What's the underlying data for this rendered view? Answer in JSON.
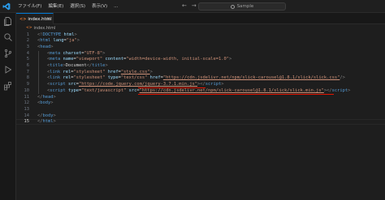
{
  "menu": [
    "ファイル(F)",
    "編集(E)",
    "選択(S)",
    "表示(V)",
    "..."
  ],
  "search": {
    "placeholder": "Sample"
  },
  "tab": {
    "label": "index.html",
    "icon": "html-file-icon"
  },
  "breadcrumb": {
    "label": "index.html"
  },
  "activity_icons": [
    "files-icon",
    "search-icon",
    "source-control-icon",
    "run-debug-icon",
    "extensions-icon"
  ],
  "editor": {
    "active_line": 15,
    "lines": [
      {
        "n": "1",
        "indent": 0,
        "tokens": [
          [
            "b",
            "<!"
          ],
          [
            "tag",
            "DOCTYPE"
          ],
          [
            "t",
            " "
          ],
          [
            "attr",
            "html"
          ],
          [
            "b",
            ">"
          ]
        ]
      },
      {
        "n": "2",
        "indent": 0,
        "tokens": [
          [
            "b",
            "<"
          ],
          [
            "tag",
            "html"
          ],
          [
            "t",
            " "
          ],
          [
            "attr",
            "lang"
          ],
          [
            "t",
            "="
          ],
          [
            "str",
            "\"ja\""
          ],
          [
            "b",
            ">"
          ]
        ]
      },
      {
        "n": "3",
        "indent": 0,
        "tokens": [
          [
            "b",
            "<"
          ],
          [
            "tag",
            "head"
          ],
          [
            "b",
            ">"
          ]
        ]
      },
      {
        "n": "4",
        "indent": 1,
        "tokens": [
          [
            "b",
            "<"
          ],
          [
            "tag",
            "meta"
          ],
          [
            "t",
            " "
          ],
          [
            "attr",
            "charset"
          ],
          [
            "t",
            "="
          ],
          [
            "str",
            "\"UTF-8\""
          ],
          [
            "b",
            ">"
          ]
        ]
      },
      {
        "n": "5",
        "indent": 1,
        "tokens": [
          [
            "b",
            "<"
          ],
          [
            "tag",
            "meta"
          ],
          [
            "t",
            " "
          ],
          [
            "attr",
            "name"
          ],
          [
            "t",
            "="
          ],
          [
            "str",
            "\"viewport\""
          ],
          [
            "t",
            " "
          ],
          [
            "attr",
            "content"
          ],
          [
            "t",
            "="
          ],
          [
            "str",
            "\"width=device-width, initial-scale=1.0\""
          ],
          [
            "b",
            ">"
          ]
        ]
      },
      {
        "n": "6",
        "indent": 1,
        "tokens": [
          [
            "b",
            "<"
          ],
          [
            "tag",
            "title"
          ],
          [
            "b",
            ">"
          ],
          [
            "t",
            "Document"
          ],
          [
            "b",
            "</"
          ],
          [
            "tag",
            "title"
          ],
          [
            "b",
            ">"
          ]
        ]
      },
      {
        "n": "7",
        "indent": 1,
        "tokens": [
          [
            "b",
            "<"
          ],
          [
            "tag",
            "link"
          ],
          [
            "t",
            " "
          ],
          [
            "attr",
            "rel"
          ],
          [
            "t",
            "="
          ],
          [
            "str",
            "\"stylesheet\""
          ],
          [
            "t",
            " "
          ],
          [
            "attr",
            "href"
          ],
          [
            "t",
            "="
          ],
          [
            "link",
            "\"style.css\""
          ],
          [
            "b",
            ">"
          ]
        ]
      },
      {
        "n": "8",
        "indent": 1,
        "tokens": [
          [
            "b",
            "<"
          ],
          [
            "tag",
            "link"
          ],
          [
            "t",
            " "
          ],
          [
            "attr",
            "rel"
          ],
          [
            "t",
            "="
          ],
          [
            "str",
            "\"stylesheet\""
          ],
          [
            "t",
            " "
          ],
          [
            "attr",
            "type"
          ],
          [
            "t",
            "="
          ],
          [
            "str",
            "\"text/css\""
          ],
          [
            "t",
            " "
          ],
          [
            "attr",
            "href"
          ],
          [
            "t",
            "="
          ],
          [
            "link",
            "\"https://cdn.jsdelivr.net/npm/slick-carousel@1.8.1/slick/slick.css\""
          ],
          [
            "b",
            "/>"
          ]
        ]
      },
      {
        "n": "9",
        "indent": 1,
        "tokens": [
          [
            "b",
            "<"
          ],
          [
            "tag",
            "script"
          ],
          [
            "t",
            " "
          ],
          [
            "attr",
            "src"
          ],
          [
            "t",
            "="
          ],
          [
            "link",
            "\"https://code.jquery.com/jquery-3.7.1.min.js\""
          ],
          [
            "b",
            "></"
          ],
          [
            "tag",
            "script"
          ],
          [
            "b",
            ">"
          ]
        ]
      },
      {
        "n": "10",
        "indent": 1,
        "tokens": [
          [
            "b",
            "<"
          ],
          [
            "tag",
            "script"
          ],
          [
            "t",
            " "
          ],
          [
            "attr",
            "type"
          ],
          [
            "t",
            "="
          ],
          [
            "str",
            "\"text/javascript\""
          ],
          [
            "t",
            " "
          ],
          [
            "attr",
            "src"
          ],
          [
            "t",
            "="
          ],
          [
            "link",
            "\"https://cdn.jsdelivr.net/npm/slick-carousel@1.8.1/slick/slick.min.js\""
          ],
          [
            "b",
            "></"
          ],
          [
            "tag",
            "script"
          ],
          [
            "b",
            ">"
          ]
        ]
      },
      {
        "n": "11",
        "indent": 0,
        "tokens": [
          [
            "b",
            "</"
          ],
          [
            "tag",
            "head"
          ],
          [
            "b",
            ">"
          ]
        ]
      },
      {
        "n": "12",
        "indent": 0,
        "tokens": [
          [
            "b",
            "<"
          ],
          [
            "tag",
            "body"
          ],
          [
            "b",
            ">"
          ]
        ]
      },
      {
        "n": "13",
        "indent": 0,
        "tokens": []
      },
      {
        "n": "14",
        "indent": 0,
        "tokens": [
          [
            "b",
            "</"
          ],
          [
            "tag",
            "body"
          ],
          [
            "b",
            ">"
          ]
        ]
      },
      {
        "n": "15",
        "indent": 0,
        "tokens": [
          [
            "b",
            "</"
          ],
          [
            "tag",
            "html"
          ],
          [
            "b",
            ">"
          ]
        ]
      }
    ]
  }
}
